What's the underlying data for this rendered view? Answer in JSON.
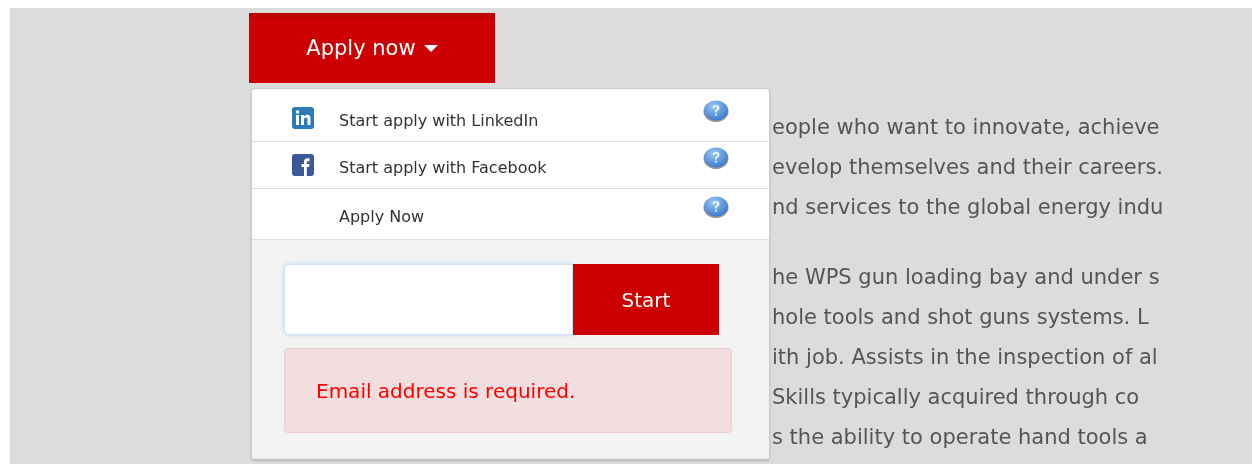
{
  "apply_button": {
    "label": "Apply now",
    "expanded": true
  },
  "menu_items": [
    {
      "kind": "linkedin",
      "label": "Start apply with LinkedIn"
    },
    {
      "kind": "facebook",
      "label": "Start apply with Facebook"
    },
    {
      "kind": "plain",
      "label": "Apply Now"
    }
  ],
  "email_form": {
    "start_button": "Start",
    "error": "Email address is required."
  },
  "background_text": [
    [
      "eople who want to innovate, achieve",
      "evelop themselves and their careers.",
      "nd services to the global energy indu"
    ],
    [
      "he WPS gun loading bay and under s",
      "hole tools and shot guns systems. L",
      "ith job. Assists in the inspection of al",
      "Skills typically acquired through co",
      "s the ability to operate hand tools a"
    ]
  ]
}
